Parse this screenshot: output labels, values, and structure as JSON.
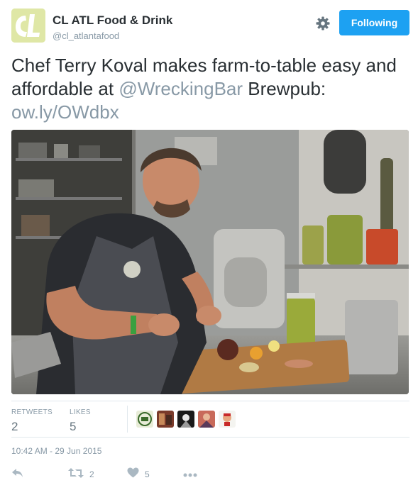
{
  "account": {
    "name": "CL ATL Food & Drink",
    "handle": "@cl_atlantafood",
    "avatar_text": "CL"
  },
  "follow_button": {
    "label": "Following"
  },
  "tweet": {
    "text_part1": "Chef Terry Koval makes farm-to-table easy and affordable at ",
    "mention": "@WreckingBar",
    "text_part2": " Brewpub: ",
    "url": "ow.ly/OWdbx"
  },
  "stats": {
    "retweets_label": "RETWEETS",
    "retweets_value": "2",
    "likes_label": "LIKES",
    "likes_value": "5"
  },
  "timestamp": "10:42 AM - 29 Jun 2015",
  "actions": {
    "retweet_count": "2",
    "like_count": "5"
  },
  "colors": {
    "accent": "#1da1f2",
    "text": "#292f33",
    "muted": "#8899a6",
    "avatar_bg": "#d9e2a0"
  },
  "icons": [
    "gear-icon",
    "reply-icon",
    "retweet-icon",
    "heart-icon",
    "more-icon"
  ]
}
